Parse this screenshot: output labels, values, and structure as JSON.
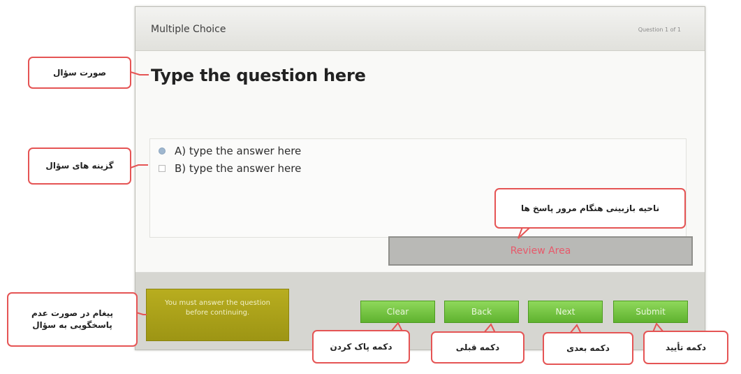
{
  "slide": {
    "title": "Multiple Choice",
    "counter": "Question 1 of 1",
    "question": "Type the question here",
    "answers": [
      {
        "label": "A) type the answer here",
        "selected": true
      },
      {
        "label": "B) type the answer here",
        "selected": false
      }
    ],
    "review_area": "Review Area",
    "warning": "You must answer the question before continuing.",
    "buttons": {
      "clear": "Clear",
      "back": "Back",
      "next": "Next",
      "submit": "Submit"
    }
  },
  "callouts": {
    "question_text": "صورت سؤال",
    "answer_options": "گزینه های سؤال",
    "review_area": "ناحیه بازبینی هنگام مرور پاسخ ها",
    "warning_message_line1": "پیغام در صورت عدم",
    "warning_message_line2": "پاسخگویی به سؤال",
    "clear_button": "دکمه پاک کردن",
    "back_button": "دکمه قبلی",
    "next_button": "دکمه بعدی",
    "submit_button": "دکمه تأیید"
  },
  "colors": {
    "callout_border": "#e55454",
    "button_green": "#6cbe3a",
    "warning_olive": "#aea41a",
    "review_text": "#e7586a"
  }
}
